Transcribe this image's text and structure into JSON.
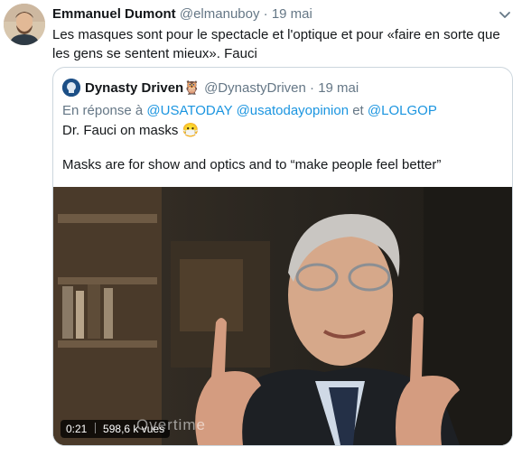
{
  "tweet": {
    "author_name": "Emmanuel Dumont",
    "author_handle": "@elmanuboy",
    "separator": "·",
    "date": "19 mai",
    "text": "Les masques sont pour le spectacle et l'optique et pour «faire en sorte que les gens se sentent mieux». Fauci"
  },
  "quoted": {
    "author_name": "Dynasty Driven",
    "author_emoji": "🦉",
    "author_handle": "@DynastyDriven",
    "date": "19 mai",
    "reply_prefix": "En réponse à",
    "reply_to": [
      "@USATODAY",
      "@usatodayopinion",
      "et",
      "@LOLGOP"
    ],
    "line1": "Dr. Fauci on masks",
    "line1_emoji": "😷",
    "line2": "Masks are for show and optics and to “make people feel better”",
    "video": {
      "duration": "0:21",
      "views": "598,6 k vues",
      "watermark": "Overtime"
    }
  },
  "icons": {
    "caret": "chevron-down-icon",
    "play": "play-icon"
  },
  "colors": {
    "link": "#1b95e0",
    "muted": "#657786",
    "border": "#ccd6dd"
  }
}
